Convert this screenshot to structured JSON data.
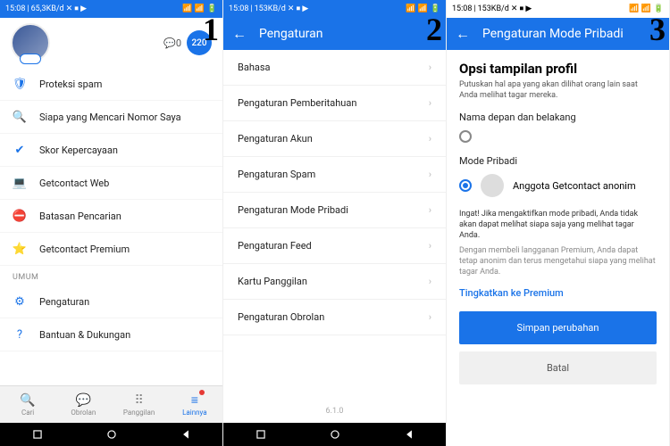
{
  "status": {
    "time": "15:08",
    "net1": "65,3KB/d",
    "net2": "153KB/d",
    "battery_icon": "85"
  },
  "screen1": {
    "msg_count": "0",
    "bubble": "220",
    "items": [
      {
        "icon": "🛡",
        "label": "Proteksi spam"
      },
      {
        "icon": "🔍",
        "label": "Siapa yang Mencari Nomor Saya"
      },
      {
        "icon": "✔",
        "label": "Skor Kepercayaan"
      },
      {
        "icon": "💻",
        "label": "Getcontact Web"
      },
      {
        "icon": "⛔",
        "label": "Batasan Pencarian"
      },
      {
        "icon": "⭐",
        "label": "Getcontact Premium"
      }
    ],
    "section_umum": "UMUM",
    "umum_items": [
      {
        "icon": "⚙",
        "label": "Pengaturan"
      },
      {
        "icon": "?",
        "label": "Bantuan & Dukungan"
      }
    ],
    "nav": [
      {
        "icon": "🔍",
        "label": "Cari"
      },
      {
        "icon": "💬",
        "label": "Obrolan"
      },
      {
        "icon": "⠿",
        "label": "Panggilan"
      },
      {
        "icon": "≡",
        "label": "Lainnya"
      }
    ]
  },
  "screen2": {
    "title": "Pengaturan",
    "items": [
      "Bahasa",
      "Pengaturan Pemberitahuan",
      "Pengaturan Akun",
      "Pengaturan Spam",
      "Pengaturan Mode Pribadi",
      "Pengaturan Feed",
      "Kartu Panggilan",
      "Pengaturan Obrolan"
    ],
    "version": "6.1.0"
  },
  "screen3": {
    "title": "Pengaturan Mode Pribadi",
    "heading": "Opsi tampilan profil",
    "sub": "Putuskan hal apa yang akan dilihat orang lain saat Anda melihat tagar mereka.",
    "opt1": "Nama depan dan belakang",
    "opt2_section": "Mode Pribadi",
    "opt2": "Anggota Getcontact anonim",
    "warn": "Ingat! Jika mengaktifkan mode pribadi, Anda tidak akan dapat melihat siapa saja yang melihat tagar Anda.",
    "warn2": "Dengan membeli langganan Premium, Anda dapat tetap anonim dan terus mengetahui siapa yang melihat tagar Anda.",
    "upgrade": "Tingkatkan ke Premium",
    "save": "Simpan perubahan",
    "cancel": "Batal"
  }
}
